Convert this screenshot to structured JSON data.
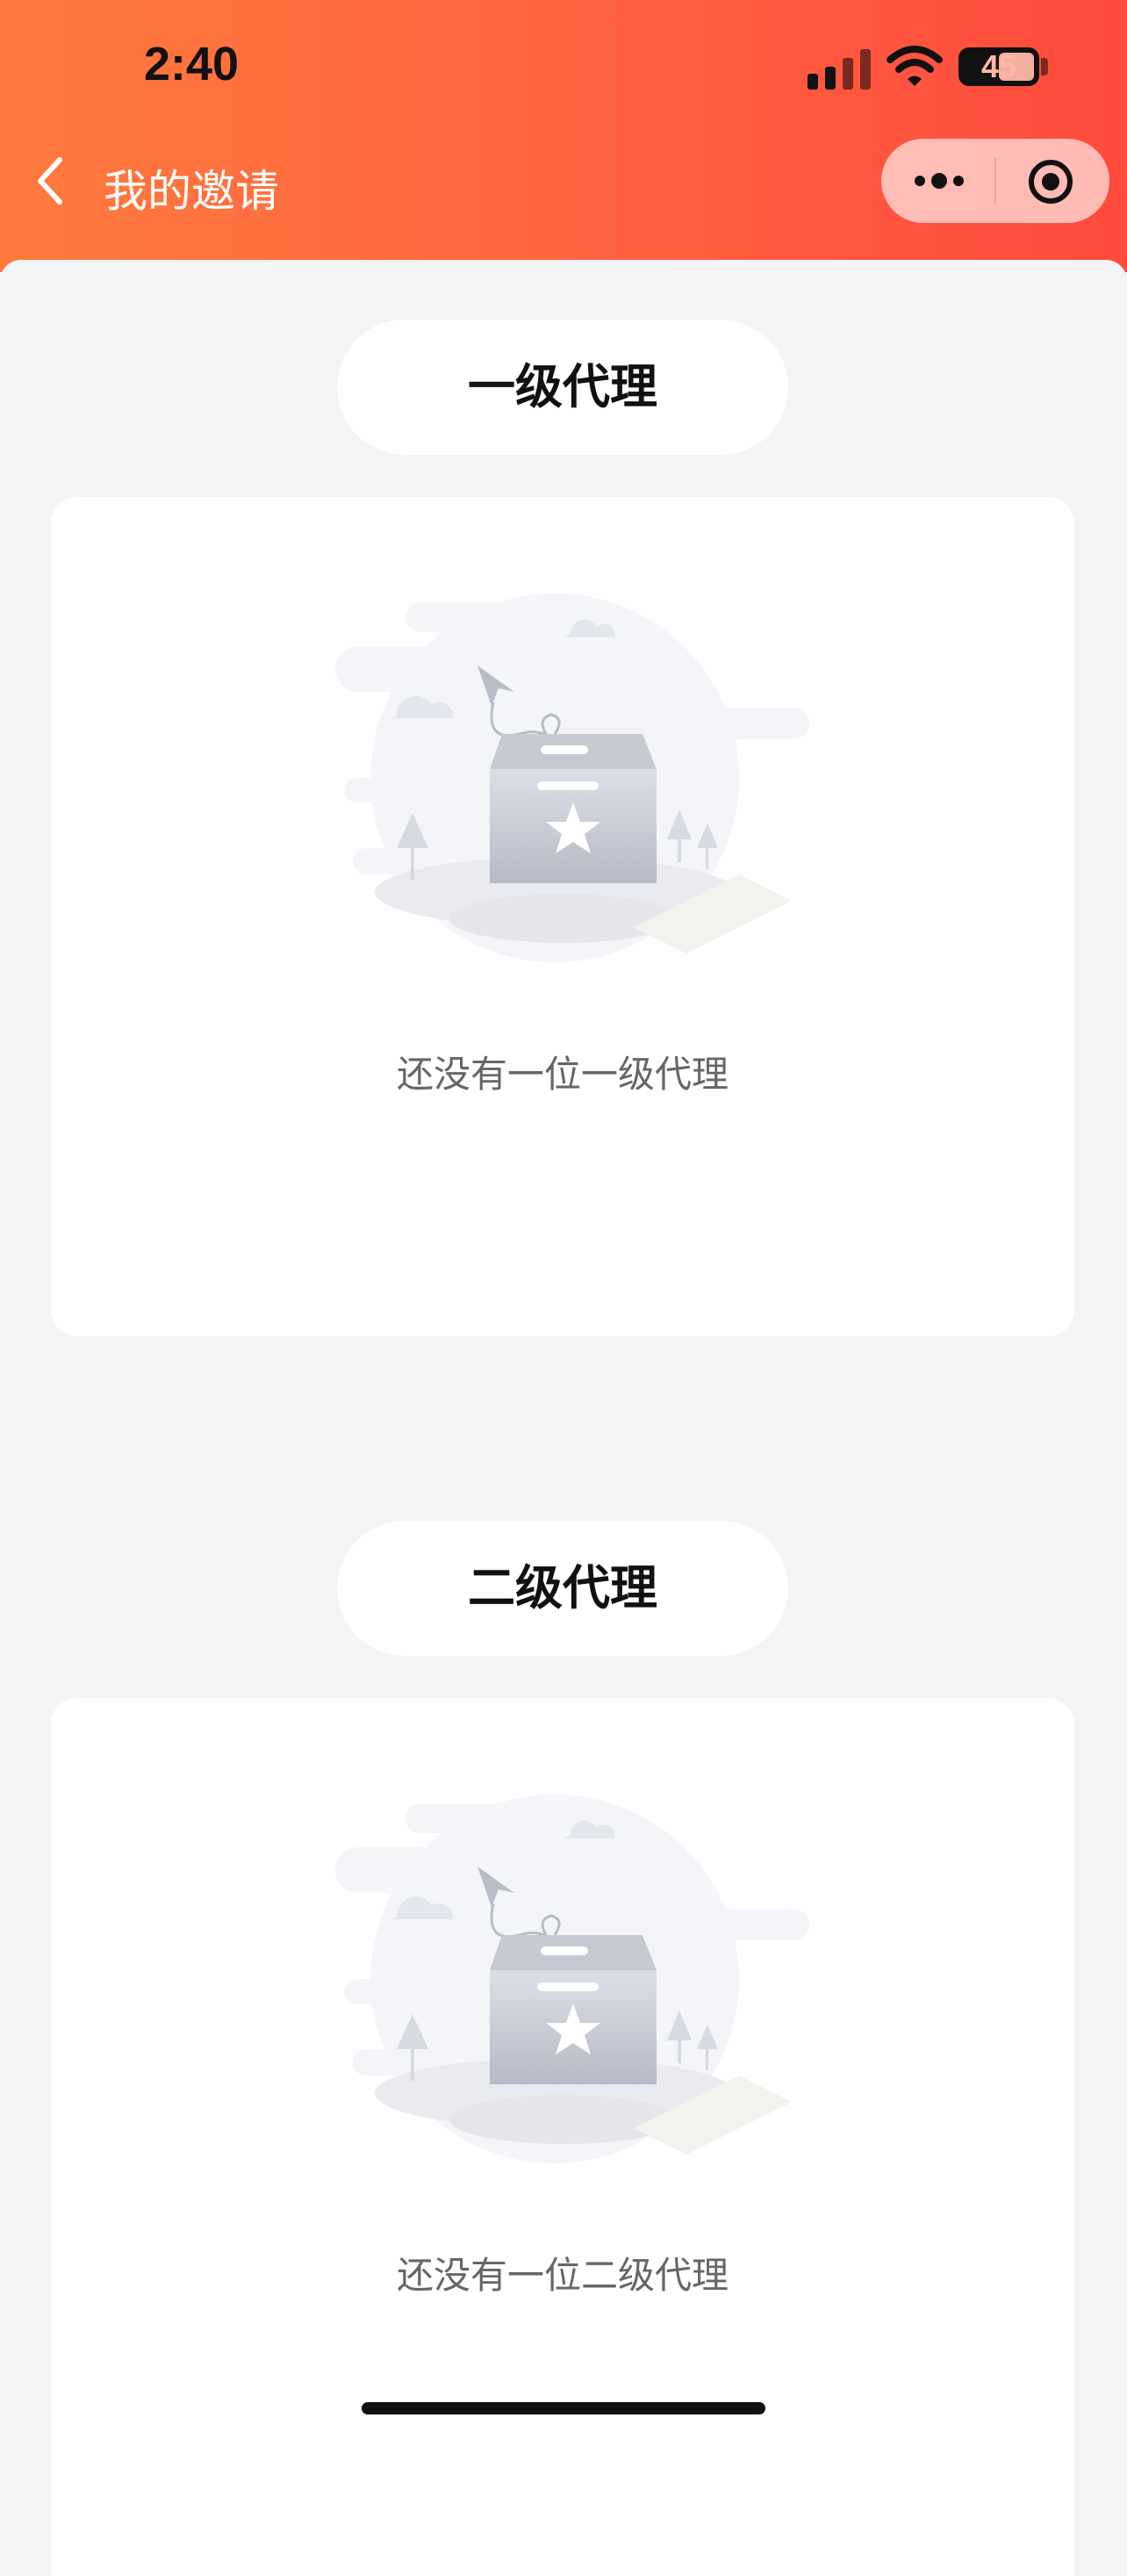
{
  "status_bar": {
    "time": "2:40",
    "battery": "45"
  },
  "nav": {
    "title": "我的邀请"
  },
  "sections": [
    {
      "label": "一级代理",
      "empty_text": "还没有一位一级代理"
    },
    {
      "label": "二级代理",
      "empty_text": "还没有一位二级代理"
    }
  ],
  "colors": {
    "header_start": "#ff7a3d",
    "header_end": "#ff4a3c",
    "background": "#f4f4f4"
  },
  "icons": [
    "back-icon",
    "more-icon",
    "target-icon",
    "empty-box-illustration",
    "signal-icon",
    "wifi-icon",
    "battery-icon"
  ]
}
